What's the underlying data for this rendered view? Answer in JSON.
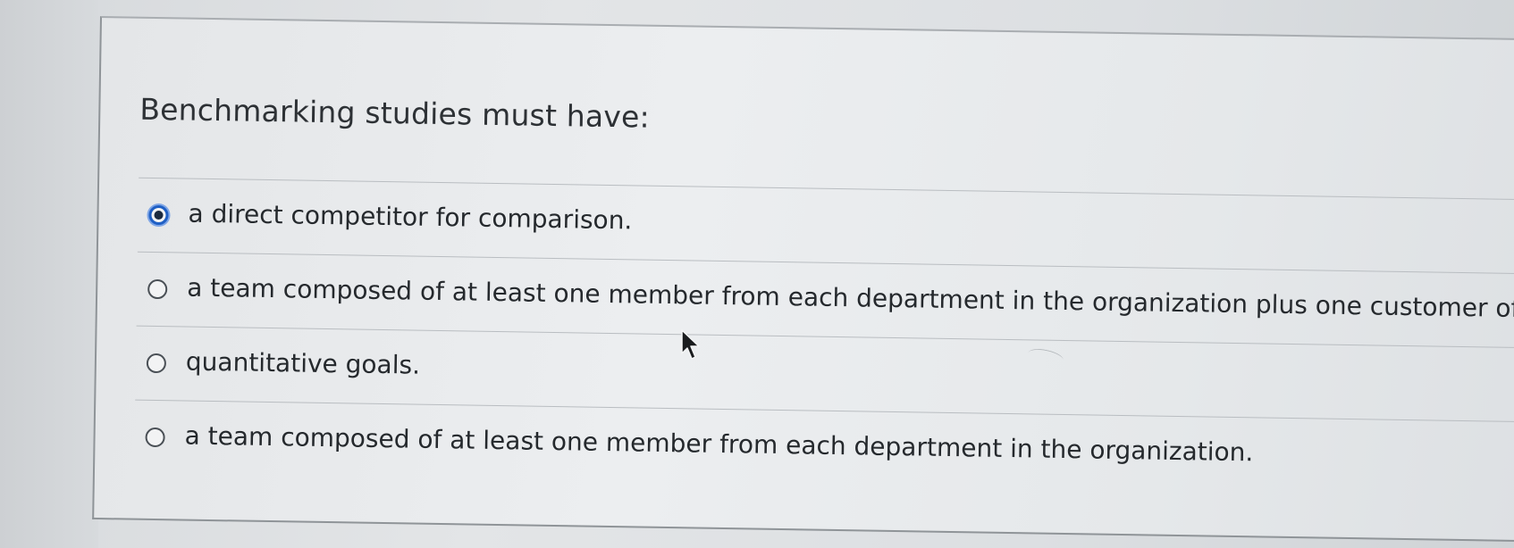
{
  "question": {
    "text": "Benchmarking studies must have:"
  },
  "options": [
    {
      "label": "a direct competitor for comparison.",
      "selected": true
    },
    {
      "label": "a team composed of at least one member from each department in the organization plus one customer of",
      "selected": false
    },
    {
      "label": "quantitative goals.",
      "selected": false
    },
    {
      "label": "a team composed of at least one member from each department in the organization.",
      "selected": false
    }
  ],
  "colors": {
    "radio_selected": "#1f5fc4",
    "text": "#25292d"
  },
  "icons": {
    "cursor": "arrow-cursor-icon"
  }
}
